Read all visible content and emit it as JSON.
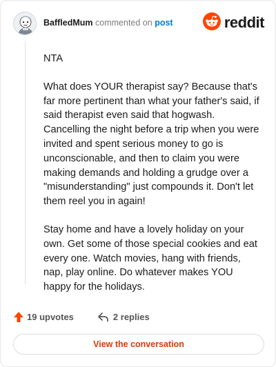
{
  "header": {
    "username": "BaffledMum",
    "action_text": "commented on",
    "link_text": "post",
    "avatar_icon": "user-avatar-icon"
  },
  "brand": {
    "logo_icon": "reddit-snoo-icon",
    "wordmark": "reddit",
    "accent_color": "#ff4500"
  },
  "comment": {
    "paragraphs": [
      "NTA",
      "What does YOUR therapist say? Because that's far more pertinent than what your father's said, if said therapist even said that hogwash. Cancelling the night before a trip when you were invited and spent serious money to go is unconscionable, and then to claim you were making demands and holding a grudge over a \"misunderstanding\" just compounds it. Don't let them reel you in again!",
      "Stay home and have a lovely holiday on your own. Get some of those special cookies and eat every one. Watch movies, hang with friends, nap, play online. Do whatever makes YOU happy for the holidays."
    ]
  },
  "actions": {
    "upvotes_label": "19 upvotes",
    "upvote_icon": "upvote-arrow-icon",
    "upvote_color": "#ff4500",
    "replies_label": "2 replies",
    "reply_icon": "reply-arrow-icon"
  },
  "cta": {
    "label": "View the conversation",
    "color": "#d93a00"
  }
}
